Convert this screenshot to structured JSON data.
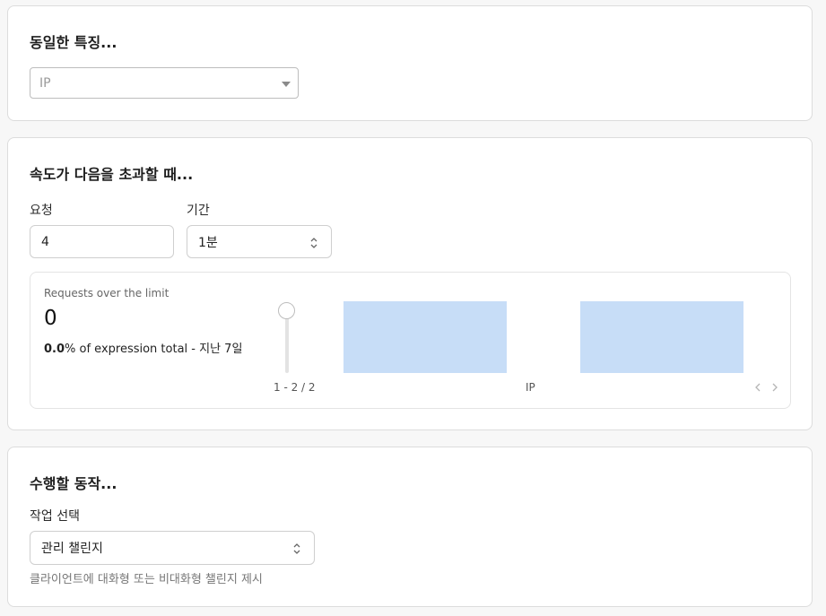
{
  "characteristics": {
    "title": "동일한 특징...",
    "select_value": "IP"
  },
  "rate": {
    "title": "속도가 다음을 초과할 때...",
    "requests_label": "요청",
    "requests_value": "4",
    "period_label": "기간",
    "period_value": "1분",
    "metric": {
      "heading": "Requests over the limit",
      "value": "0",
      "percent": "0.0",
      "percent_suffix": "% of expression total - 지난 7일",
      "slider_level": 1.0,
      "pagination": "1 - 2 / 2",
      "group_label": "IP",
      "bars": [
        {
          "value": 1,
          "color": "#c7ddf7"
        },
        {
          "value": 1,
          "color": "#c7ddf7"
        }
      ]
    }
  },
  "action": {
    "title": "수행할 동작...",
    "select_label": "작업 선택",
    "select_value": "관리 챌린지",
    "hint": "클라이언트에 대화형 또는 비대화형 챌린지 제시"
  },
  "icons": {
    "dropdown": "chevron-down-icon",
    "stepper": "up-down-chevron-icon",
    "prev": "chevron-left-icon",
    "next": "chevron-right-icon"
  }
}
